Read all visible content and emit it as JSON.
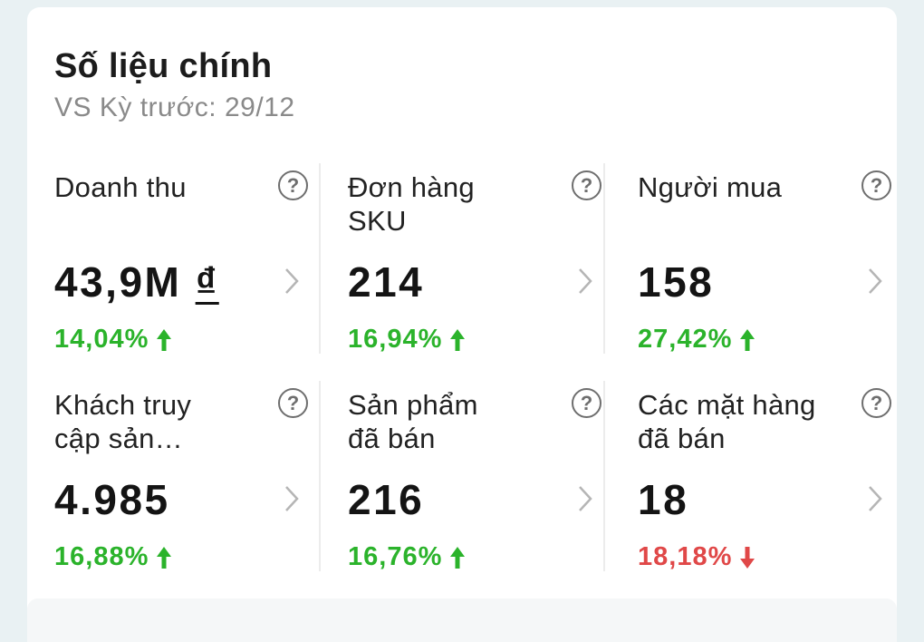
{
  "section": {
    "title": "Số liệu chính",
    "subtitle": "VS Kỳ trước: 29/12"
  },
  "metrics": [
    {
      "label": "Doanh thu",
      "value": "43,9M",
      "currency": "₫",
      "change": "14,04%",
      "direction": "up",
      "help_icon": "question-circle-icon"
    },
    {
      "label": "Đơn hàng SKU",
      "value": "214",
      "change": "16,94%",
      "direction": "up",
      "help_icon": "question-circle-icon"
    },
    {
      "label": "Người mua",
      "value": "158",
      "change": "27,42%",
      "direction": "up",
      "help_icon": "question-circle-icon"
    },
    {
      "label": "Khách truy cập sản…",
      "value": "4.985",
      "change": "16,88%",
      "direction": "up",
      "help_icon": "question-circle-icon"
    },
    {
      "label": "Sản phẩm đã bán",
      "value": "216",
      "change": "16,76%",
      "direction": "up",
      "help_icon": "question-circle-icon"
    },
    {
      "label": "Các mặt hàng đã bán",
      "value": "18",
      "change": "18,18%",
      "direction": "down",
      "help_icon": "question-circle-icon"
    }
  ],
  "colors": {
    "up": "#2bb32b",
    "down": "#e04848",
    "background": "#e9f1f3",
    "card": "#ffffff"
  },
  "help_glyph": "?"
}
